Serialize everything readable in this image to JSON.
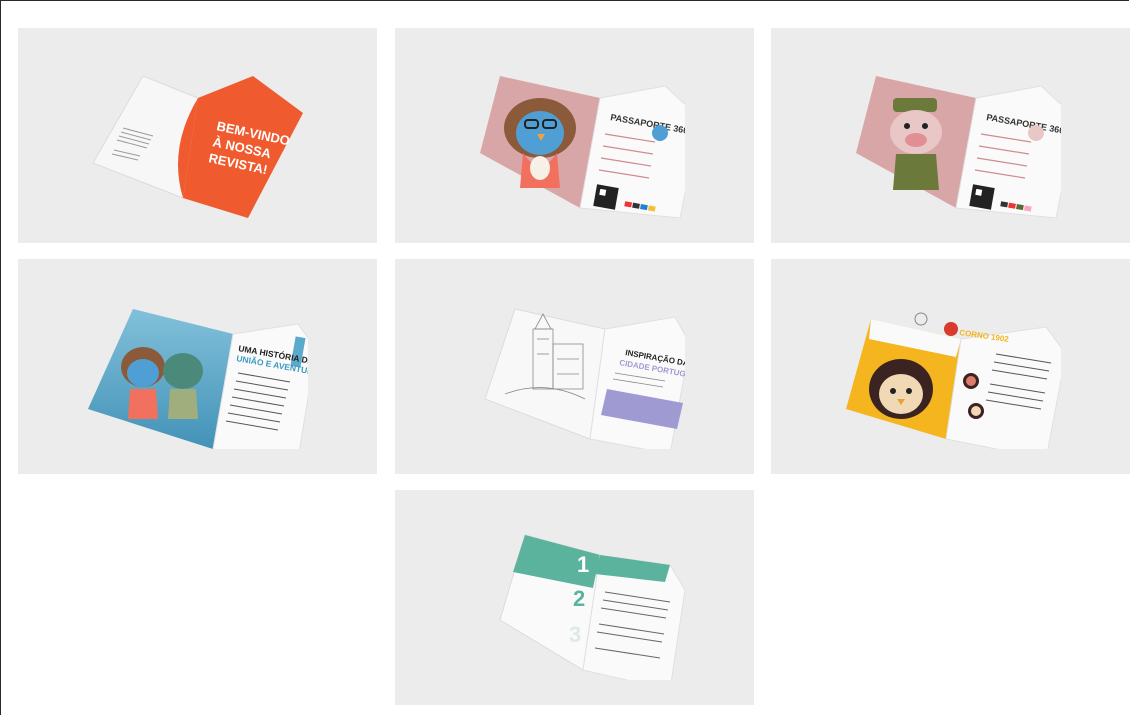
{
  "gallery": {
    "tiles": [
      {
        "name": "welcome-spread",
        "headline": [
          "BEM-VINDO",
          "À NOSSA",
          "REVISTA!"
        ],
        "accent": "#ef5a2e"
      },
      {
        "name": "passport-penguin",
        "heading": "PASSAPORTE 360",
        "accent": "#d9a6a8"
      },
      {
        "name": "passport-pig",
        "heading": "PASSAPORTE 360",
        "accent": "#d9a6a8"
      },
      {
        "name": "story-spread",
        "heading_line1": "UMA HISTÓRIA DE",
        "heading_line2": "UNIÃO E AVENTURA",
        "accent": "#3d9ac0"
      },
      {
        "name": "coloring-spread",
        "heading_line1": "INSPIRAÇÃO DA",
        "heading_line2": "CIDADE PORTUGUESA",
        "accent": "#9f9ad2"
      },
      {
        "name": "character-spread",
        "heading": "CORNO 1902",
        "accent": "#f4b51f"
      },
      {
        "name": "numbered-spread",
        "numbers": [
          "1",
          "2",
          "3"
        ],
        "accent": "#5bb39d"
      }
    ]
  }
}
